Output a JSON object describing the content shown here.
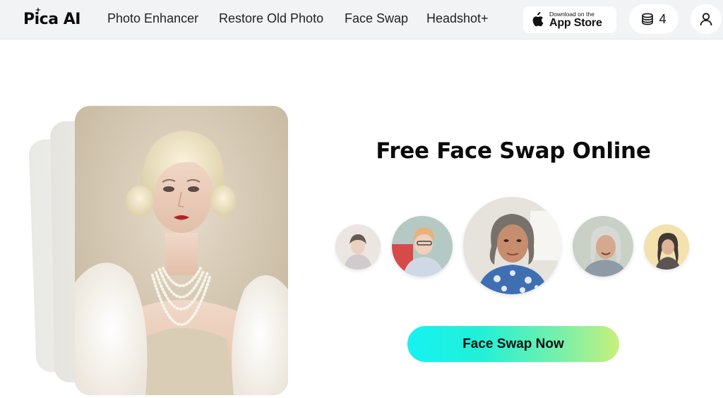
{
  "header": {
    "logo_text": "Pica AI",
    "nav": [
      {
        "label": "Photo Enhancer"
      },
      {
        "label": "Restore Old Photo"
      },
      {
        "label": "Face Swap"
      },
      {
        "label": "Headshot+"
      }
    ],
    "app_store": {
      "small": "Download on the",
      "big": "App Store"
    },
    "credits": "4"
  },
  "hero": {
    "title": "Free Face Swap Online",
    "cta_label": "Face Swap Now"
  },
  "colors": {
    "cta_gradient_start": "#14f2f2",
    "cta_gradient_end": "#c8f07a",
    "header_bg": "#f2f3f5"
  },
  "icons": [
    "logo-spark-icon",
    "apple-icon",
    "coins-icon",
    "user-icon"
  ]
}
